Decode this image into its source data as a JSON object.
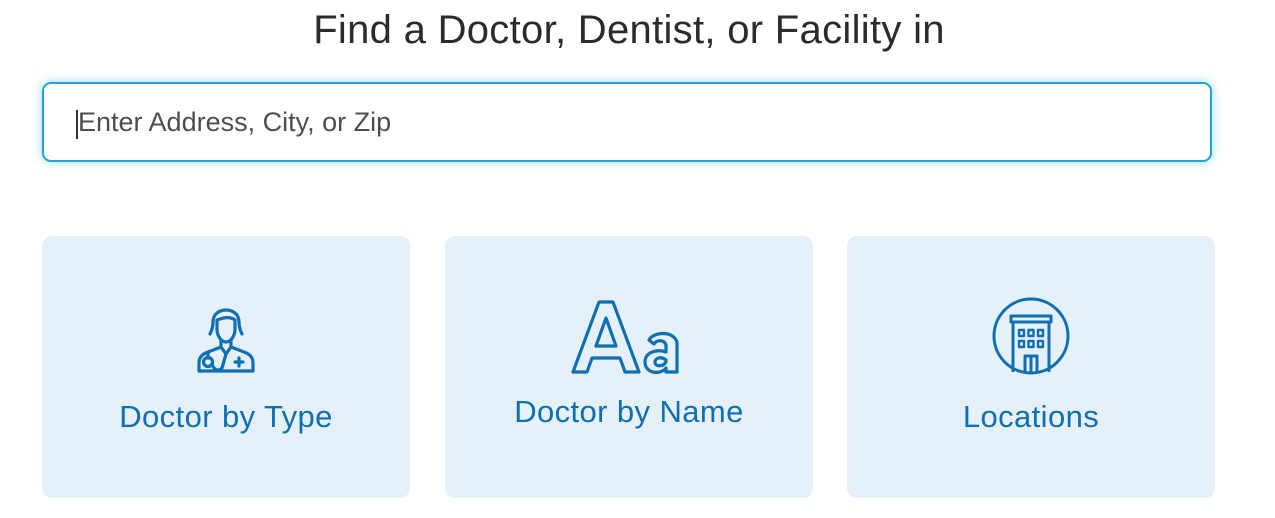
{
  "header": {
    "title": "Find a Doctor, Dentist, or Facility in"
  },
  "search": {
    "placeholder": "Enter Address, City, or Zip",
    "value": ""
  },
  "cards": [
    {
      "label": "Doctor by Type",
      "icon": "doctor-icon"
    },
    {
      "label": "Doctor by Name",
      "icon": "letters-aa-icon"
    },
    {
      "label": "Locations",
      "icon": "building-icon"
    }
  ],
  "colors": {
    "accent": "#0f6fb3",
    "card_background": "#e5f0f8",
    "search_border": "#1fa7d2",
    "title_text": "#2b2b2b"
  }
}
